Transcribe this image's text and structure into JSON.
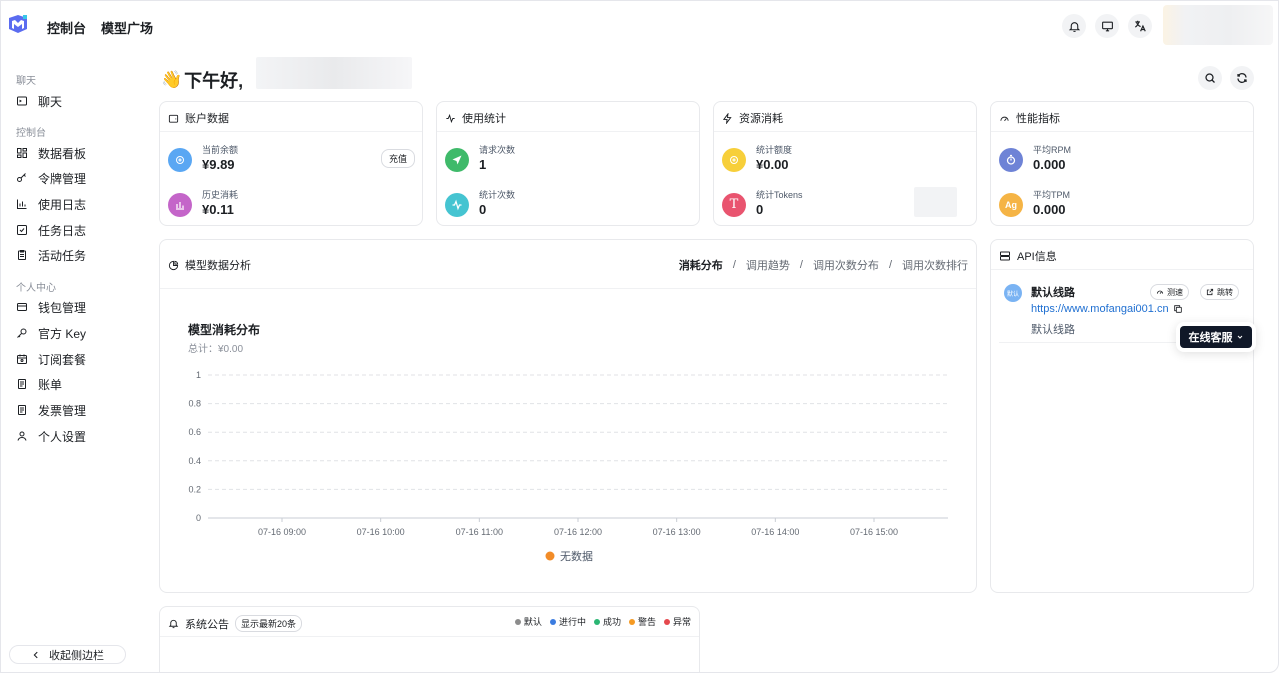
{
  "header": {
    "nav": [
      "控制台",
      "模型广场"
    ],
    "icons": [
      "bell-icon",
      "monitor-icon",
      "translate-icon"
    ]
  },
  "sidebar": {
    "sections": [
      {
        "label": "聊天",
        "items": [
          {
            "label": "聊天",
            "icon": "chat-icon"
          }
        ]
      },
      {
        "label": "控制台",
        "items": [
          {
            "label": "数据看板",
            "icon": "dashboard-icon"
          },
          {
            "label": "令牌管理",
            "icon": "key-icon"
          },
          {
            "label": "使用日志",
            "icon": "chart-icon"
          },
          {
            "label": "任务日志",
            "icon": "checklist-icon"
          },
          {
            "label": "活动任务",
            "icon": "clipboard-icon"
          }
        ]
      },
      {
        "label": "个人中心",
        "items": [
          {
            "label": "钱包管理",
            "icon": "wallet-icon"
          },
          {
            "label": "官方 Key",
            "icon": "key-icon"
          },
          {
            "label": "订阅套餐",
            "icon": "calendar-icon"
          },
          {
            "label": "账单",
            "icon": "document-icon"
          },
          {
            "label": "发票管理",
            "icon": "document-icon"
          },
          {
            "label": "个人设置",
            "icon": "user-icon"
          }
        ]
      }
    ],
    "collapse_label": "收起侧边栏"
  },
  "greeting": {
    "emoji": "👋",
    "text": "下午好,"
  },
  "cards": {
    "account": {
      "title": "账户数据",
      "stats": [
        {
          "label": "当前余额",
          "value": "¥9.89",
          "color": "#5aa7f3"
        },
        {
          "label": "历史消耗",
          "value": "¥0.11",
          "color": "#c465c9"
        }
      ],
      "recharge_label": "充值"
    },
    "usage": {
      "title": "使用统计",
      "stats": [
        {
          "label": "请求次数",
          "value": "1",
          "color": "#3fba6a"
        },
        {
          "label": "统计次数",
          "value": "0",
          "color": "#45c4d1"
        }
      ]
    },
    "resource": {
      "title": "资源消耗",
      "stats": [
        {
          "label": "统计额度",
          "value": "¥0.00",
          "color": "#f7cf3a"
        },
        {
          "label": "统计Tokens",
          "value": "0",
          "color": "#e9546f"
        }
      ]
    },
    "performance": {
      "title": "性能指标",
      "stats": [
        {
          "label": "平均RPM",
          "value": "0.000",
          "color": "#6e83d6"
        },
        {
          "label": "平均TPM",
          "value": "0.000",
          "color": "#f5b445"
        }
      ]
    }
  },
  "analysis": {
    "title": "模型数据分析",
    "tabs": [
      "消耗分布",
      "调用趋势",
      "调用次数分布",
      "调用次数排行"
    ],
    "active_tab": 0,
    "chart_title": "模型消耗分布",
    "chart_subtitle": "总计：¥0.00"
  },
  "chart_data": {
    "type": "bar",
    "title": "模型消耗分布",
    "subtitle": "总计：¥0.00",
    "categories": [
      "07-16 09:00",
      "07-16 10:00",
      "07-16 11:00",
      "07-16 12:00",
      "07-16 13:00",
      "07-16 14:00",
      "07-16 15:00"
    ],
    "series": [
      {
        "name": "无数据",
        "values": [
          0,
          0,
          0,
          0,
          0,
          0,
          0
        ],
        "color": "#f28c28"
      }
    ],
    "yticks": [
      "0",
      "0.2",
      "0.4",
      "0.6",
      "0.8",
      "1"
    ],
    "ylim": [
      0,
      1
    ],
    "grid": true,
    "legend": "bottom"
  },
  "api": {
    "title": "API信息",
    "badge": "默认",
    "name": "默认线路",
    "url": "https://www.mofangai001.cn",
    "description": "默认线路",
    "speed_test_label": "测速",
    "jump_label": "跳转",
    "support_label": "在线客服"
  },
  "announcement": {
    "title": "系统公告",
    "pill": "显示最新20条",
    "legend": [
      {
        "label": "默认",
        "color": "#8c8c8c"
      },
      {
        "label": "进行中",
        "color": "#3b7ce0"
      },
      {
        "label": "成功",
        "color": "#2bb673"
      },
      {
        "label": "警告",
        "color": "#f59a23"
      },
      {
        "label": "异常",
        "color": "#e5484d"
      }
    ]
  }
}
